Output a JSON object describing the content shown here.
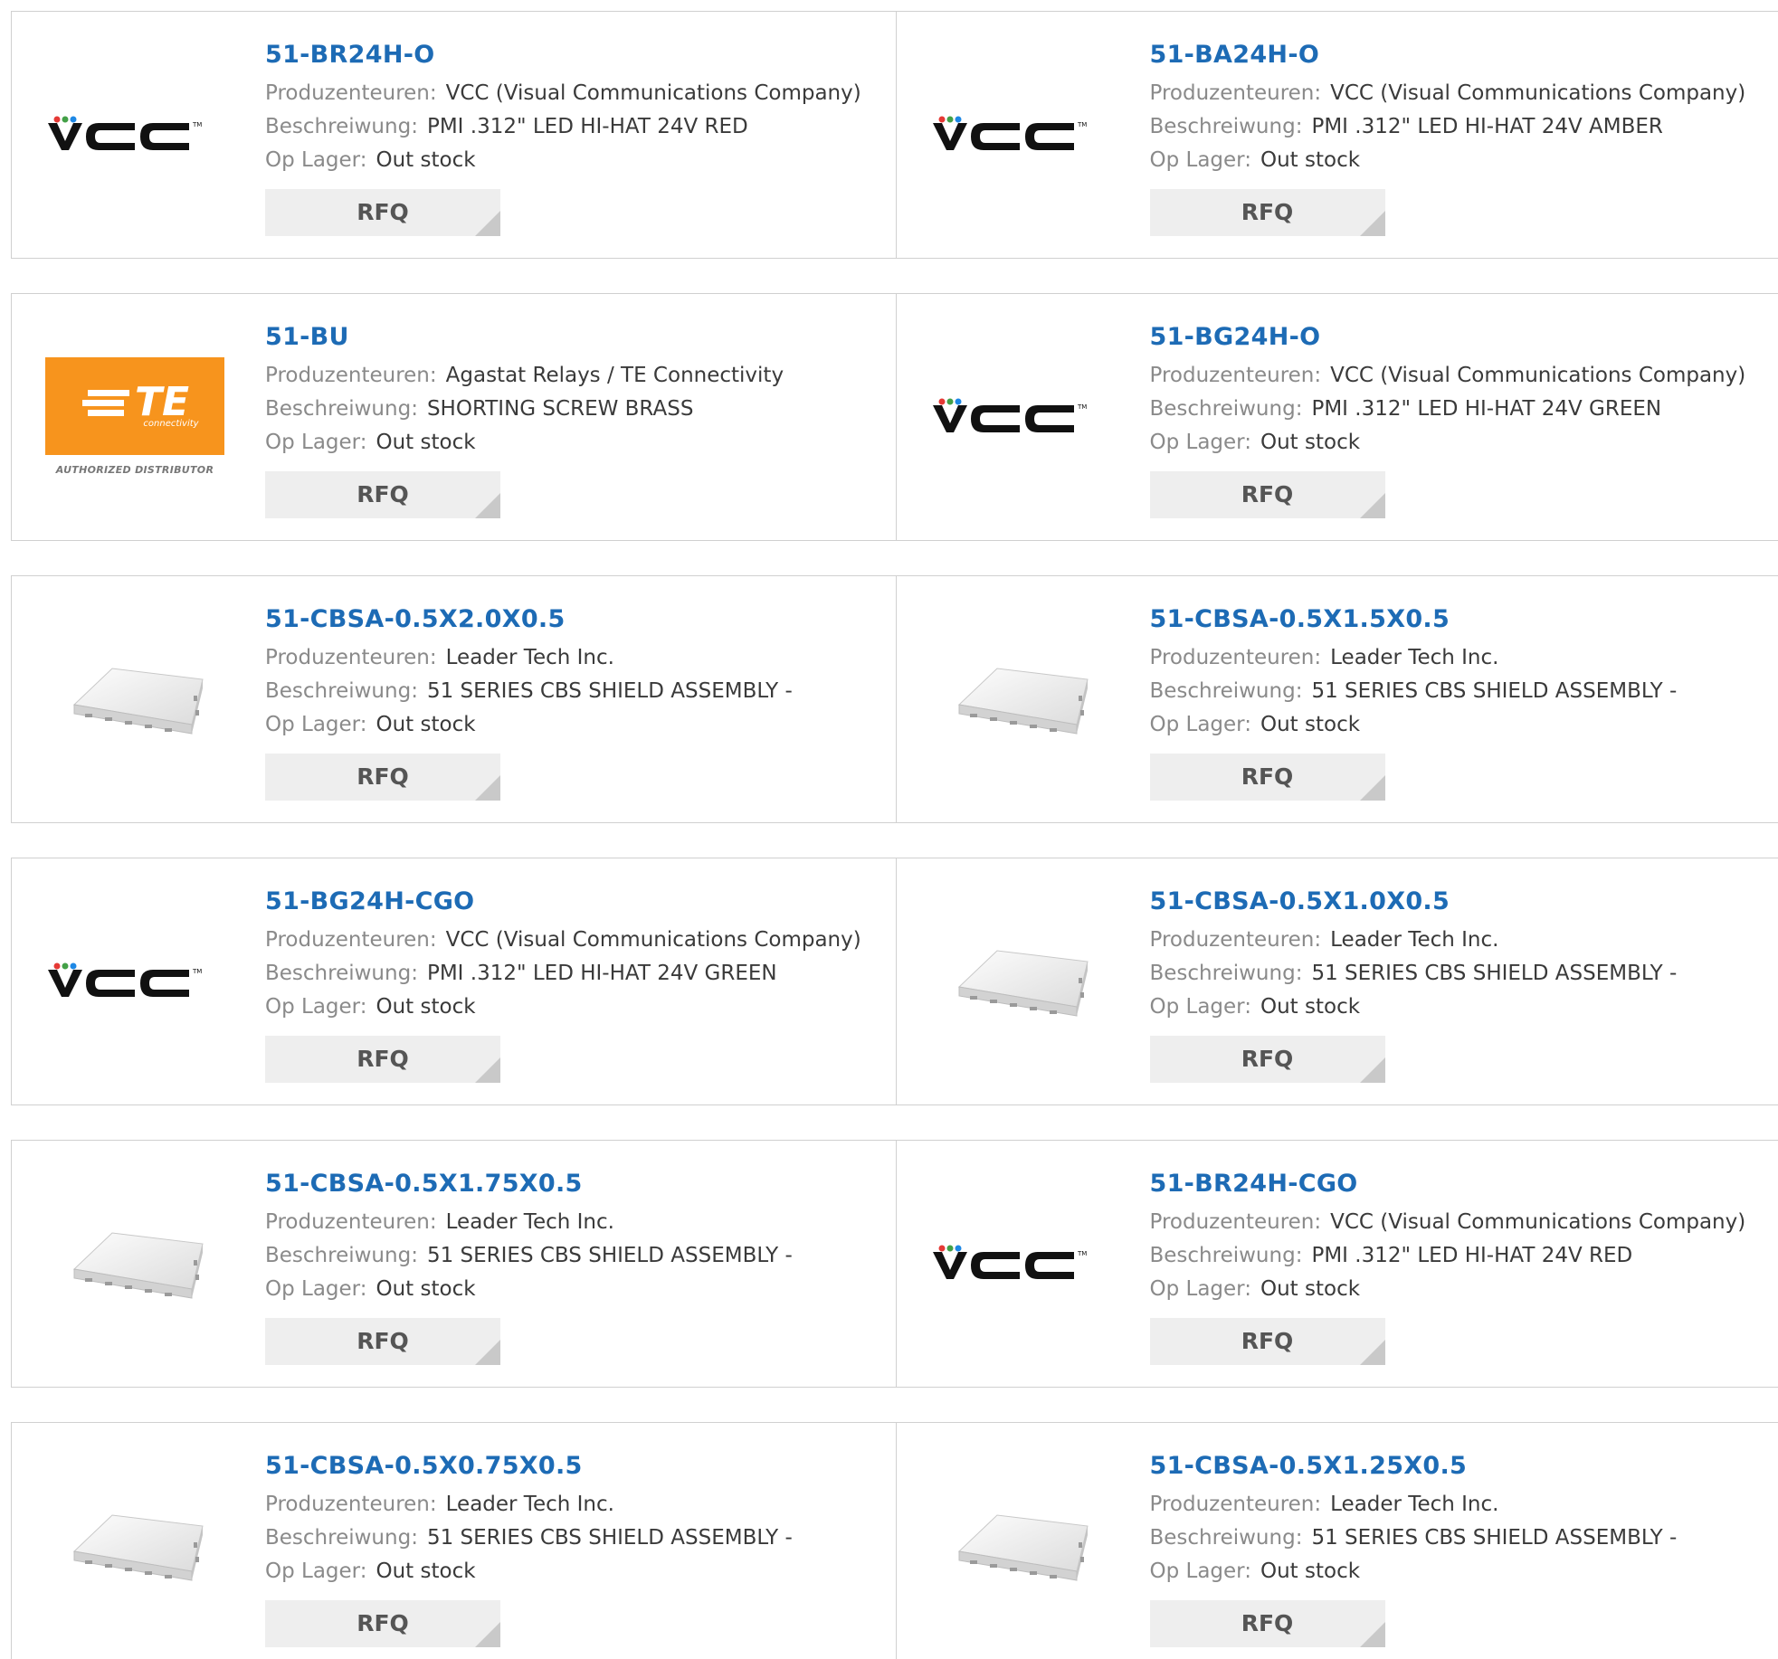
{
  "labels": {
    "manufacturer": "Produzenteuren:",
    "description": "Beschreiwung:",
    "stock": "Op Lager:"
  },
  "colors": {
    "part_link": "#1d6bb5",
    "te_orange": "#f7941d",
    "rfq_bg": "#eeeeee"
  },
  "products": [
    {
      "part": "51-BR24H-O",
      "manufacturer": "VCC (Visual Communications Company)",
      "description": "PMI .312\" LED HI-HAT 24V RED",
      "stock": "Out stock",
      "rfq": "RFQ",
      "logo": "vcc-logo"
    },
    {
      "part": "51-BA24H-O",
      "manufacturer": "VCC (Visual Communications Company)",
      "description": "PMI .312\" LED HI-HAT 24V AMBER",
      "stock": "Out stock",
      "rfq": "RFQ",
      "logo": "vcc-logo"
    },
    {
      "part": "51-BU",
      "manufacturer": "Agastat Relays / TE Connectivity",
      "description": "SHORTING SCREW BRASS",
      "stock": "Out stock",
      "rfq": "RFQ",
      "logo": "te-logo"
    },
    {
      "part": "51-BG24H-O",
      "manufacturer": "VCC (Visual Communications Company)",
      "description": "PMI .312\" LED HI-HAT 24V GREEN",
      "stock": "Out stock",
      "rfq": "RFQ",
      "logo": "vcc-logo"
    },
    {
      "part": "51-CBSA-0.5X2.0X0.5",
      "manufacturer": "Leader Tech Inc.",
      "description": "51 SERIES CBS SHIELD ASSEMBLY -",
      "stock": "Out stock",
      "rfq": "RFQ",
      "logo": "shield-image"
    },
    {
      "part": "51-CBSA-0.5X1.5X0.5",
      "manufacturer": "Leader Tech Inc.",
      "description": "51 SERIES CBS SHIELD ASSEMBLY -",
      "stock": "Out stock",
      "rfq": "RFQ",
      "logo": "shield-image"
    },
    {
      "part": "51-BG24H-CGO",
      "manufacturer": "VCC (Visual Communications Company)",
      "description": "PMI .312\" LED HI-HAT 24V GREEN",
      "stock": "Out stock",
      "rfq": "RFQ",
      "logo": "vcc-logo"
    },
    {
      "part": "51-CBSA-0.5X1.0X0.5",
      "manufacturer": "Leader Tech Inc.",
      "description": "51 SERIES CBS SHIELD ASSEMBLY -",
      "stock": "Out stock",
      "rfq": "RFQ",
      "logo": "shield-image"
    },
    {
      "part": "51-CBSA-0.5X1.75X0.5",
      "manufacturer": "Leader Tech Inc.",
      "description": "51 SERIES CBS SHIELD ASSEMBLY -",
      "stock": "Out stock",
      "rfq": "RFQ",
      "logo": "shield-image"
    },
    {
      "part": "51-BR24H-CGO",
      "manufacturer": "VCC (Visual Communications Company)",
      "description": "PMI .312\" LED HI-HAT 24V RED",
      "stock": "Out stock",
      "rfq": "RFQ",
      "logo": "vcc-logo"
    },
    {
      "part": "51-CBSA-0.5X0.75X0.5",
      "manufacturer": "Leader Tech Inc.",
      "description": "51 SERIES CBS SHIELD ASSEMBLY -",
      "stock": "Out stock",
      "rfq": "RFQ",
      "logo": "shield-image"
    },
    {
      "part": "51-CBSA-0.5X1.25X0.5",
      "manufacturer": "Leader Tech Inc.",
      "description": "51 SERIES CBS SHIELD ASSEMBLY -",
      "stock": "Out stock",
      "rfq": "RFQ",
      "logo": "shield-image"
    }
  ],
  "te_logo": {
    "mark": "TE",
    "tagline": "connectivity",
    "caption": "AUTHORIZED DISTRIBUTOR"
  }
}
